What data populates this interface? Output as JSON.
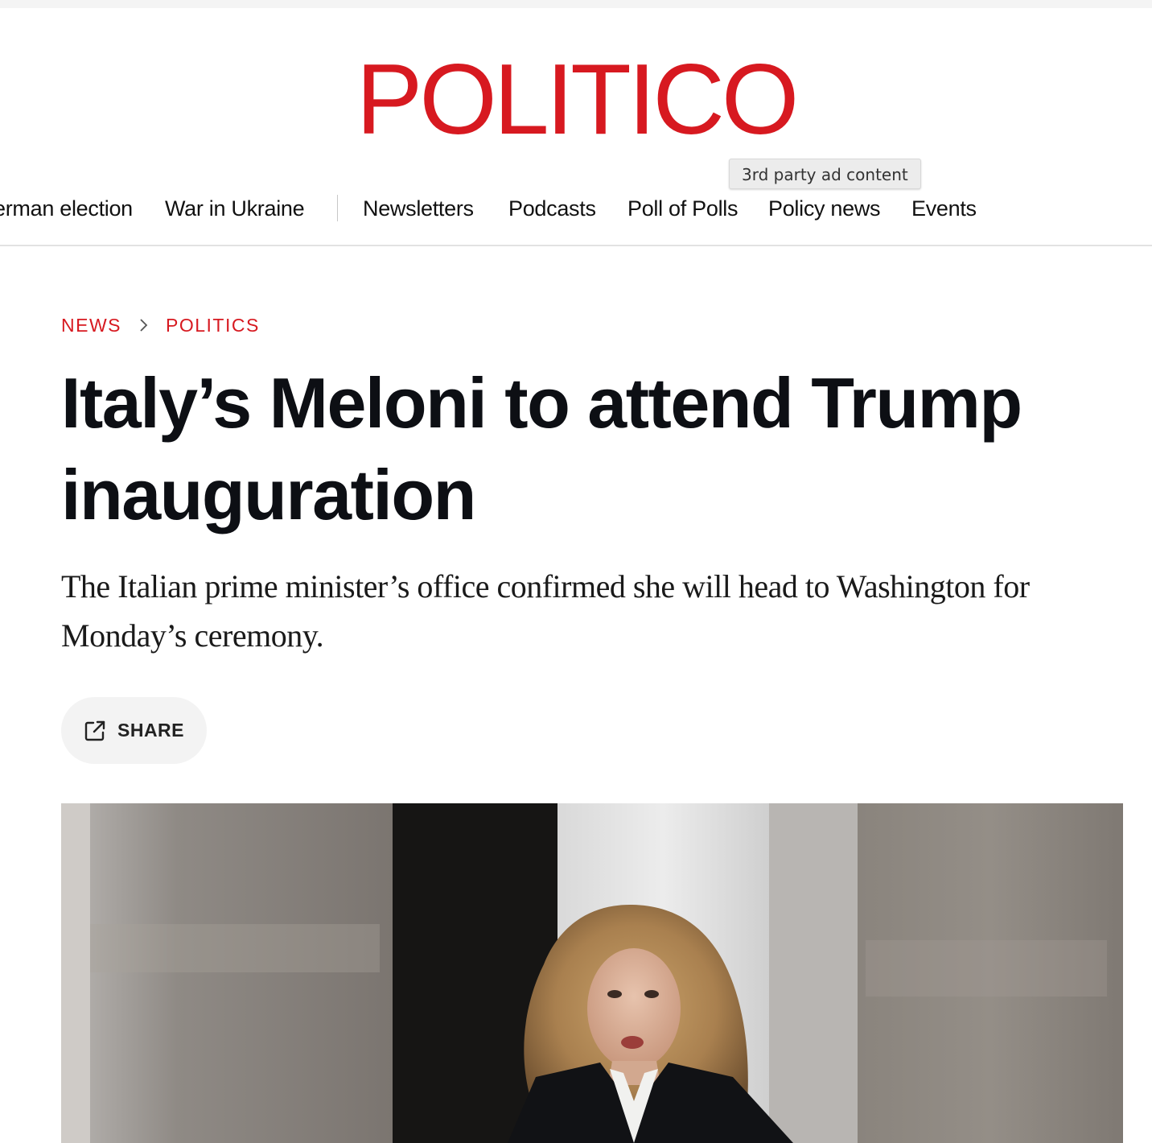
{
  "header": {
    "logo_text": "POLITICO",
    "brand_color": "#d71920"
  },
  "tooltip": {
    "text": "3rd party ad content"
  },
  "nav": {
    "items": [
      {
        "label": "erman election"
      },
      {
        "label": "War in Ukraine"
      },
      {
        "label": "Newsletters"
      },
      {
        "label": "Podcasts"
      },
      {
        "label": "Poll of Polls"
      },
      {
        "label": "Policy news"
      },
      {
        "label": "Events"
      }
    ]
  },
  "breadcrumb": {
    "items": [
      {
        "label": "NEWS"
      },
      {
        "label": "POLITICS"
      }
    ],
    "separator": "chevron-right-icon"
  },
  "article": {
    "headline": "Italy’s Meloni to attend Trump inauguration",
    "dek": "The Italian prime minister’s office confirmed she will head to Washington for Monday’s ceremony.",
    "share_label": "SHARE",
    "share_icon": "external-link-icon"
  }
}
